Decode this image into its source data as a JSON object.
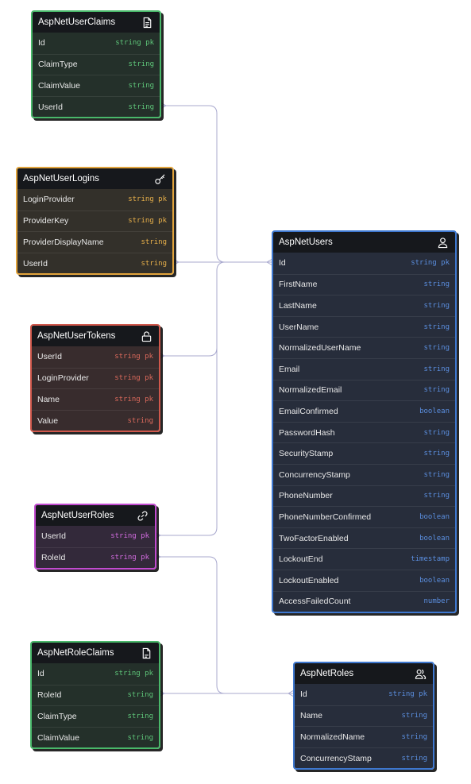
{
  "colors": {
    "green": "#49b86a",
    "yellow": "#e2a43c",
    "red": "#d0584c",
    "magenta": "#c24ad0",
    "blue": "#3e78d0",
    "connector": "#a8a8ce"
  },
  "tables": {
    "user_claims": {
      "title": "AspNetUserClaims",
      "icon": "document-icon",
      "color": "green",
      "rows": [
        {
          "name": "Id",
          "type": "string pk"
        },
        {
          "name": "ClaimType",
          "type": "string"
        },
        {
          "name": "ClaimValue",
          "type": "string"
        },
        {
          "name": "UserId",
          "type": "string"
        }
      ]
    },
    "user_logins": {
      "title": "AspNetUserLogins",
      "icon": "key-icon",
      "color": "yellow",
      "rows": [
        {
          "name": "LoginProvider",
          "type": "string pk"
        },
        {
          "name": "ProviderKey",
          "type": "string pk"
        },
        {
          "name": "ProviderDisplayName",
          "type": "string"
        },
        {
          "name": "UserId",
          "type": "string"
        }
      ]
    },
    "user_tokens": {
      "title": "AspNetUserTokens",
      "icon": "lock-open-icon",
      "color": "red",
      "rows": [
        {
          "name": "UserId",
          "type": "string pk"
        },
        {
          "name": "LoginProvider",
          "type": "string pk"
        },
        {
          "name": "Name",
          "type": "string pk"
        },
        {
          "name": "Value",
          "type": "string"
        }
      ]
    },
    "user_roles": {
      "title": "AspNetUserRoles",
      "icon": "link-icon",
      "color": "magenta",
      "rows": [
        {
          "name": "UserId",
          "type": "string pk"
        },
        {
          "name": "RoleId",
          "type": "string pk"
        }
      ]
    },
    "role_claims": {
      "title": "AspNetRoleClaims",
      "icon": "document-icon",
      "color": "green",
      "rows": [
        {
          "name": "Id",
          "type": "string pk"
        },
        {
          "name": "RoleId",
          "type": "string"
        },
        {
          "name": "ClaimType",
          "type": "string"
        },
        {
          "name": "ClaimValue",
          "type": "string"
        }
      ]
    },
    "users": {
      "title": "AspNetUsers",
      "icon": "user-icon",
      "color": "blue",
      "rows": [
        {
          "name": "Id",
          "type": "string pk"
        },
        {
          "name": "FirstName",
          "type": "string"
        },
        {
          "name": "LastName",
          "type": "string"
        },
        {
          "name": "UserName",
          "type": "string"
        },
        {
          "name": "NormalizedUserName",
          "type": "string"
        },
        {
          "name": "Email",
          "type": "string"
        },
        {
          "name": "NormalizedEmail",
          "type": "string"
        },
        {
          "name": "EmailConfirmed",
          "type": "boolean"
        },
        {
          "name": "PasswordHash",
          "type": "string"
        },
        {
          "name": "SecurityStamp",
          "type": "string"
        },
        {
          "name": "ConcurrencyStamp",
          "type": "string"
        },
        {
          "name": "PhoneNumber",
          "type": "string"
        },
        {
          "name": "PhoneNumberConfirmed",
          "type": "boolean"
        },
        {
          "name": "TwoFactorEnabled",
          "type": "boolean"
        },
        {
          "name": "LockoutEnd",
          "type": "timestamp"
        },
        {
          "name": "LockoutEnabled",
          "type": "boolean"
        },
        {
          "name": "AccessFailedCount",
          "type": "number"
        }
      ]
    },
    "roles": {
      "title": "AspNetRoles",
      "icon": "users-icon",
      "color": "blue",
      "rows": [
        {
          "name": "Id",
          "type": "string pk"
        },
        {
          "name": "Name",
          "type": "string"
        },
        {
          "name": "NormalizedName",
          "type": "string"
        },
        {
          "name": "ConcurrencyStamp",
          "type": "string"
        }
      ]
    }
  },
  "relationships": [
    {
      "from": "user_claims.UserId",
      "to": "users.Id",
      "cardinality": "many-to-one"
    },
    {
      "from": "user_logins.UserId",
      "to": "users.Id",
      "cardinality": "many-to-one"
    },
    {
      "from": "user_tokens.UserId",
      "to": "users.Id",
      "cardinality": "many-to-one"
    },
    {
      "from": "user_roles.UserId",
      "to": "users.Id",
      "cardinality": "many-to-one"
    },
    {
      "from": "user_roles.RoleId",
      "to": "roles.Id",
      "cardinality": "many-to-one"
    },
    {
      "from": "role_claims.RoleId",
      "to": "roles.Id",
      "cardinality": "many-to-one"
    }
  ]
}
